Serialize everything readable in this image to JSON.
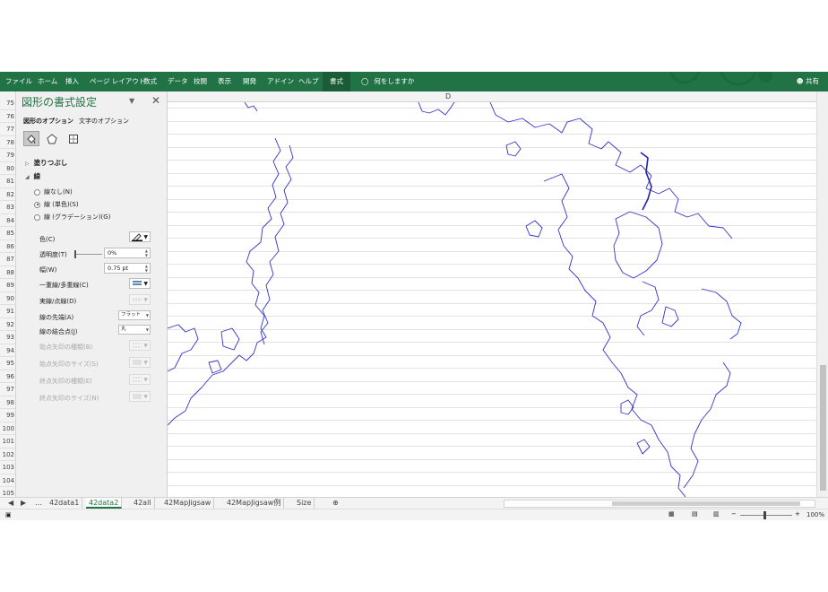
{
  "ribbon": {
    "tabs": [
      "ファイル",
      "ホーム",
      "挿入",
      "ページ レイアウト",
      "数式",
      "データ",
      "校閲",
      "表示",
      "開発",
      "アドイン",
      "ヘルプ",
      "書式"
    ],
    "active_tab": "書式",
    "tell_me": "何をしますか",
    "share": "共有",
    "color": "#217346"
  },
  "column_header": "D",
  "rows": [
    "75",
    "76",
    "77",
    "78",
    "79",
    "80",
    "81",
    "82",
    "83",
    "84",
    "85",
    "86",
    "87",
    "88",
    "89",
    "90",
    "91",
    "92",
    "93",
    "94",
    "95",
    "96",
    "97",
    "98",
    "99",
    "100",
    "101",
    "102",
    "103",
    "104",
    "105"
  ],
  "pane": {
    "title": "図形の書式設定",
    "option_tabs": [
      "図形のオプション",
      "文字のオプション"
    ],
    "icons": [
      "fill-line-icon",
      "pentagon-icon",
      "size-properties-icon"
    ],
    "fill_section": "塗りつぶし",
    "line_section": "線",
    "radio_options": [
      "線なし(N)",
      "線 (単色)(S)",
      "線 (グラデーション)(G)"
    ],
    "selected_radio": "線 (単色)(S)",
    "props": {
      "color_label": "色(C)",
      "transparency_label": "透明度(T)",
      "transparency_value": "0%",
      "width_label": "幅(W)",
      "width_value": "0.75 pt",
      "compound_label": "一重線/多重線(C)",
      "dash_label": "実線/点線(D)",
      "cap_label": "線の先端(A)",
      "cap_value": "フラット",
      "join_label": "線の結合点(J)",
      "join_value": "丸",
      "begin_arrow_type": "始点矢印の種類(B)",
      "begin_arrow_size": "始点矢印のサイズ(S)",
      "end_arrow_type": "終点矢印の種類(E)",
      "end_arrow_size": "終点矢印のサイズ(N)"
    }
  },
  "sheet_tabs": [
    "42data1",
    "42data2",
    "42all",
    "42MapJigsaw",
    "42MapJigsaw例",
    "Size"
  ],
  "active_sheet": "42data2",
  "status": {
    "zoom": "100%"
  },
  "map_line_color": "#3333cc"
}
